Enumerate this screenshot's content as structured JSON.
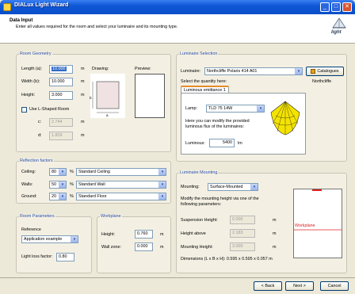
{
  "window": {
    "title": "DIALux Light Wizard"
  },
  "header": {
    "title": "Data Input",
    "subtitle": "Enter all values required for the room and select your luminaire and its mounting type.",
    "logo_text": "light"
  },
  "room_geometry": {
    "title": "Room Geometry",
    "length_label": "Length (a):",
    "length_value": "10.000",
    "length_unit": "m",
    "width_label": "Width (b):",
    "width_value": "10.000",
    "width_unit": "m",
    "height_label": "Height:",
    "height_value": "3.000",
    "height_unit": "m",
    "lshape_label": "Use L-Shaped Room",
    "c_label": "c:",
    "c_value": "2.744",
    "c_unit": "m",
    "d_label": "d:",
    "d_value": "1.829",
    "d_unit": "m",
    "drawing_label": "Drawing:",
    "preview_label": "Preview:",
    "drawing_a": "a",
    "drawing_b": "b"
  },
  "reflection": {
    "title": "Reflection factors",
    "rows": [
      {
        "label": "Ceiling:",
        "value": "80",
        "unit": "%",
        "material": "Standard Ceiling"
      },
      {
        "label": "Walls:",
        "value": "50",
        "unit": "%",
        "material": "Standard Wall"
      },
      {
        "label": "Ground:",
        "value": "20",
        "unit": "%",
        "material": "Standard Floor"
      }
    ]
  },
  "room_params": {
    "title": "Room Parameters",
    "reference_label": "Reference",
    "reference_value": "Application example",
    "llf_label": "Light loss factor:",
    "llf_value": "0.80"
  },
  "workplane": {
    "title": "Workplane",
    "height_label": "Height:",
    "height_value": "0.760",
    "height_unit": "m",
    "wallzone_label": "Wall zone:",
    "wallzone_value": "0.000",
    "wallzone_unit": "m"
  },
  "luminaire": {
    "title": "Luminaire Selection",
    "luminaire_label": "Luminaire:",
    "luminaire_value": "Northcliffe Polaris 414 A01",
    "catalogues_label": "Catalogues",
    "quantity_label": "Select the quantity here:",
    "manufacturer": "Northcliffe",
    "tab_label": "Luminous emittance 1",
    "lamp_label": "Lamp:",
    "lamp_value": "TLD 75 14W",
    "modify_text": "Here you can modify the provided luminous flux of the luminaires:",
    "luminous_label": "Luminous:",
    "luminous_value": "5400",
    "luminous_unit": "lm"
  },
  "mounting": {
    "title": "Luminaire Mounting",
    "mounting_label": "Mounting:",
    "mounting_value": "Surface-Mounted",
    "modify_text": "Modify the mounting height via one of the following parameters:",
    "suspension_label": "Suspension Height:",
    "suspension_value": "0.000",
    "suspension_unit": "m",
    "above_label": "Height above",
    "above_value": "2.183",
    "above_unit": "m",
    "mounting_height_label": "Mounting Height:",
    "mounting_height_value": "3.000",
    "mounting_height_unit": "m",
    "dimensions_text": "Dimensions (L x B x H): 0.595 x 0.595 x 0.057 m",
    "workplane_label": "Workplane"
  },
  "footer": {
    "back_label": "< Back",
    "next_label": "Next >",
    "cancel_label": "Cancel"
  },
  "colors": {
    "titlebar": "#0f57d6",
    "group_title": "#2b4dab",
    "selection": "#316ac5",
    "workplane_line": "#e02020"
  }
}
